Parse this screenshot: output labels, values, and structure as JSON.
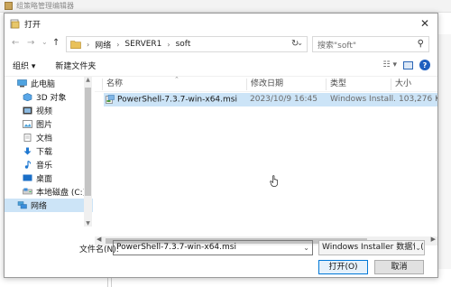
{
  "background": {
    "app_title": "组策略管理编辑器"
  },
  "dialog": {
    "title": "打开",
    "close_glyph": "✕"
  },
  "nav": {
    "back": "←",
    "forward": "→",
    "recent": "⌄",
    "up": "↑",
    "refresh": "↻"
  },
  "address": {
    "segments": [
      "网络",
      "SERVER1",
      "soft"
    ],
    "separator": "›"
  },
  "search": {
    "placeholder": "搜索\"soft\""
  },
  "toolbar": {
    "organize": "组织 ▾",
    "new_folder": "新建文件夹"
  },
  "sidebar": {
    "items": [
      {
        "label": "此电脑",
        "icon": "computer-icon"
      },
      {
        "label": "3D 对象",
        "icon": "3d-objects-icon"
      },
      {
        "label": "视频",
        "icon": "video-icon"
      },
      {
        "label": "图片",
        "icon": "pictures-icon"
      },
      {
        "label": "文档",
        "icon": "documents-icon"
      },
      {
        "label": "下载",
        "icon": "downloads-icon"
      },
      {
        "label": "音乐",
        "icon": "music-icon"
      },
      {
        "label": "桌面",
        "icon": "desktop-icon"
      },
      {
        "label": "本地磁盘 (C:)",
        "icon": "drive-icon"
      },
      {
        "label": "网络",
        "icon": "network-icon"
      }
    ],
    "selected": "网络"
  },
  "columns": {
    "name": "名称",
    "date": "修改日期",
    "type": "类型",
    "size": "大小"
  },
  "files": [
    {
      "name": "PowerShell-7.3.7-win-x64.msi",
      "date": "2023/10/9 16:45",
      "type": "Windows Install...",
      "size": "103,276 K"
    }
  ],
  "footer": {
    "filename_label": "文件名(N):",
    "filename_value": "PowerShell-7.3.7-win-x64.msi",
    "filetype_value": "Windows Installer 数据包(*.m",
    "open_button": "打开(O)",
    "cancel_button": "取消"
  },
  "colors": {
    "selection": "#cce4f7",
    "accent": "#0078d7"
  }
}
